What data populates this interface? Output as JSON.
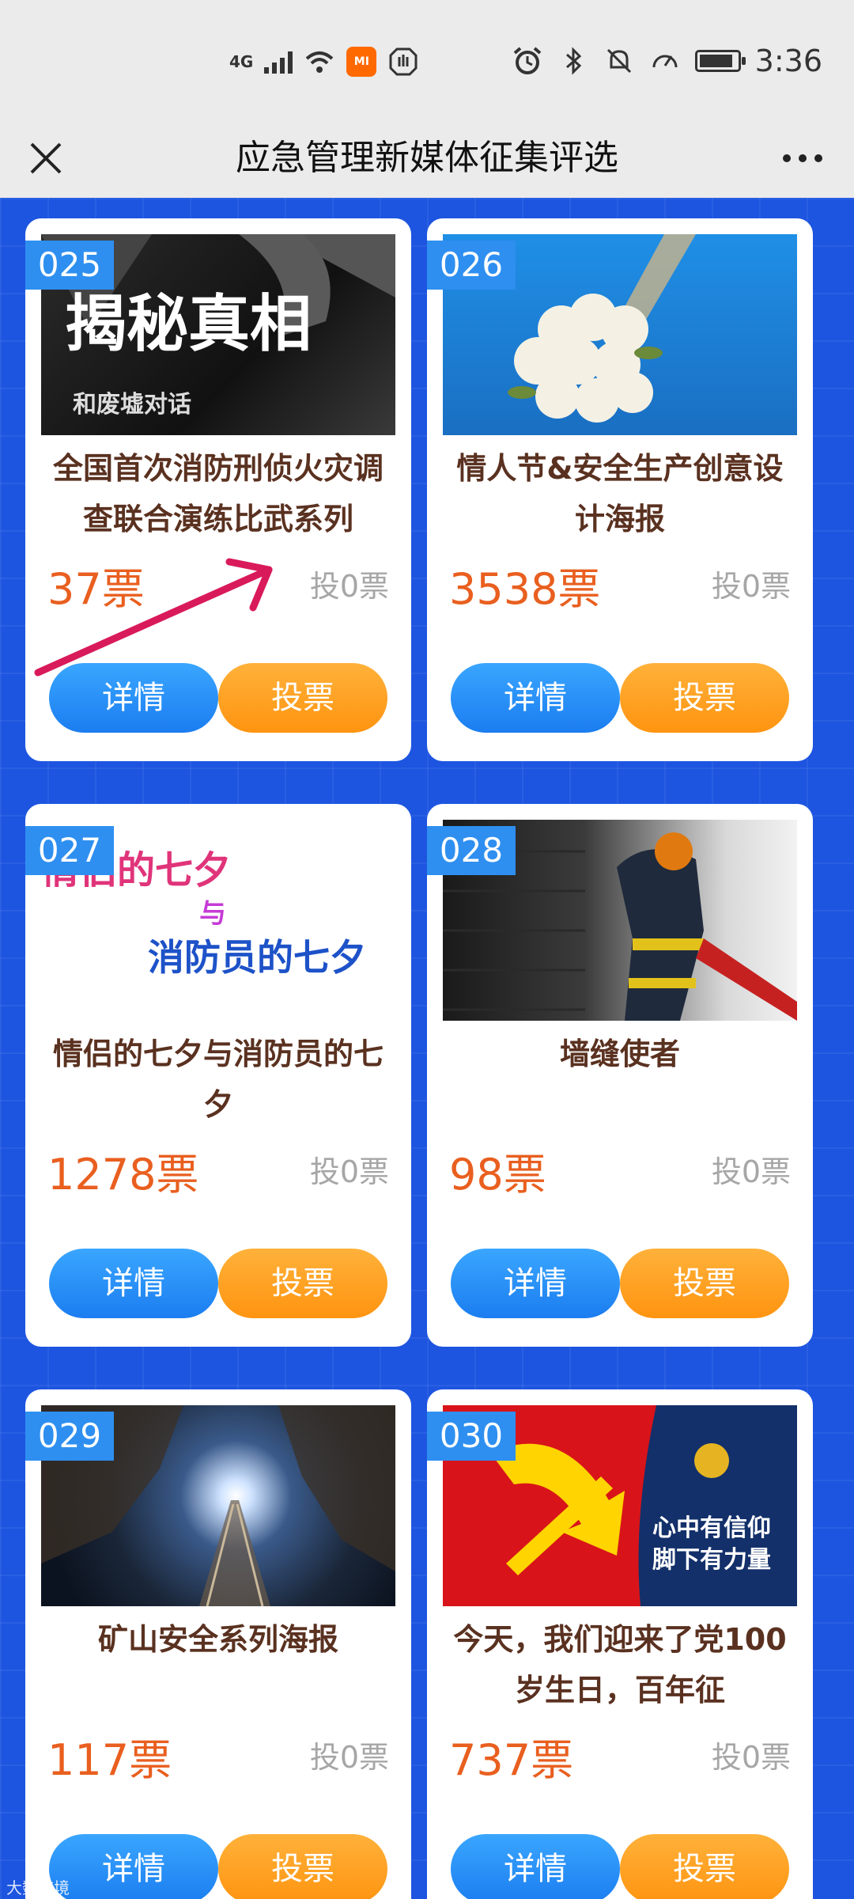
{
  "status_bar": {
    "network": "4G",
    "time": "3:36",
    "mi_label": "MI"
  },
  "header": {
    "title": "应急管理新媒体征集评选"
  },
  "cards": [
    {
      "num": "025",
      "title": "全国首次消防刑侦火灾调查联合演练比武系列",
      "votes": "37票",
      "my_votes": "投0票",
      "detail_label": "详情",
      "vote_label": "投票",
      "thumb_lines": [
        "揭秘真相",
        "和废墟对话"
      ]
    },
    {
      "num": "026",
      "title": "情人节&安全生产创意设计海报",
      "votes": "3538票",
      "my_votes": "投0票",
      "detail_label": "详情",
      "vote_label": "投票"
    },
    {
      "num": "027",
      "title": "情侣的七夕与消防员的七夕",
      "votes": "1278票",
      "my_votes": "投0票",
      "detail_label": "详情",
      "vote_label": "投票",
      "thumb_lines": [
        "情侣的七夕",
        "与",
        "消防员的七夕"
      ]
    },
    {
      "num": "028",
      "title": "墙缝使者",
      "votes": "98票",
      "my_votes": "投0票",
      "detail_label": "详情",
      "vote_label": "投票"
    },
    {
      "num": "029",
      "title": "矿山安全系列海报",
      "votes": "117票",
      "my_votes": "投0票",
      "detail_label": "详情",
      "vote_label": "投票"
    },
    {
      "num": "030",
      "title": "今天，我们迎来了党100岁生日，百年征",
      "votes": "737票",
      "my_votes": "投0票",
      "detail_label": "详情",
      "vote_label": "投票",
      "thumb_lines": [
        "心中有信仰",
        "脚下有力量"
      ]
    }
  ],
  "watermark": "大数跨境",
  "colors": {
    "accent_blue": "#1d55e0",
    "vote_orange": "#e95f1f"
  }
}
